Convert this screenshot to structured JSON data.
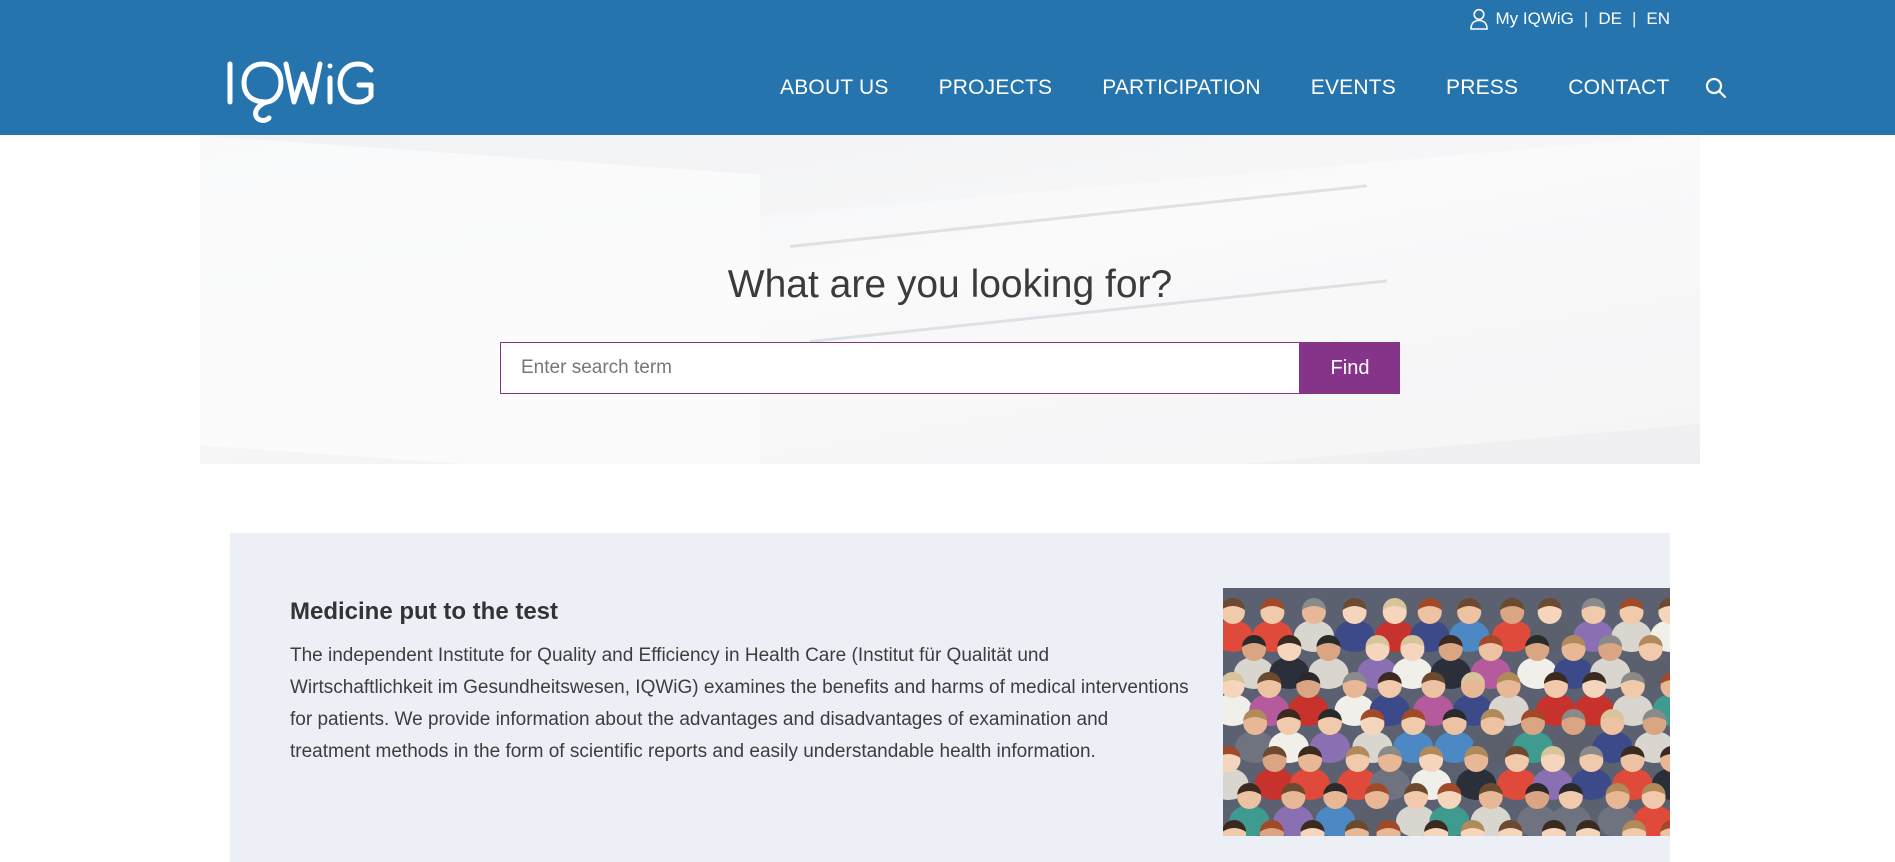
{
  "header": {
    "logo_text": "IQWiG",
    "utility": {
      "my_account": "My IQWiG",
      "separator": "|",
      "lang_de": "DE",
      "lang_en": "EN"
    },
    "nav": [
      {
        "label": "ABOUT US"
      },
      {
        "label": "PROJECTS"
      },
      {
        "label": "PARTICIPATION"
      },
      {
        "label": "EVENTS"
      },
      {
        "label": "PRESS"
      },
      {
        "label": "CONTACT"
      }
    ],
    "icons": {
      "user": "user-icon",
      "search": "search-icon"
    },
    "background_color": "#2574ad"
  },
  "hero": {
    "title": "What are you looking for?",
    "search": {
      "placeholder": "Enter search term",
      "value": "",
      "button_label": "Find"
    },
    "accent_color": "#86338a"
  },
  "intro": {
    "heading": "Medicine put to the test",
    "body": "The independent Institute for Quality and Efficiency in Health Care (Institut für Qualität und Wirtschaftlichkeit im Gesundheitswesen, IQWiG) examines the benefits and harms of medical interventions for patients. We provide information about the advantages and disadvantages of examination and treatment methods in the form of scientific reports and easily understandable health information.",
    "image": "team-group-photo",
    "background_color": "#ecf0f6"
  }
}
